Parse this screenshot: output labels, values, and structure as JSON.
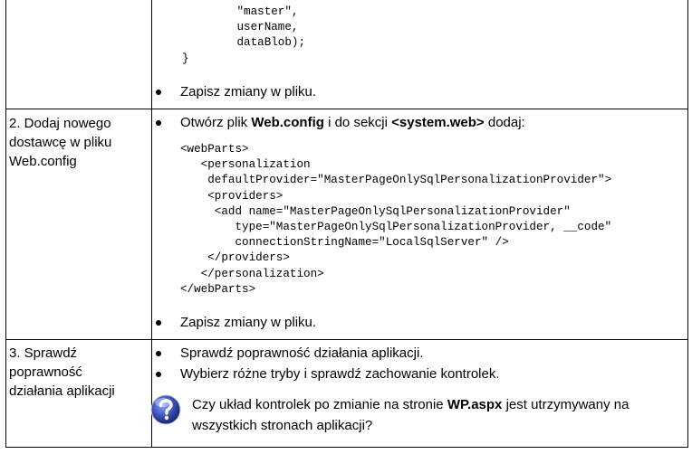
{
  "row1": {
    "code": "        \"master\",\n        userName,\n        dataBlob);\n}",
    "bullet": "Zapisz zmiany w pliku."
  },
  "row2": {
    "label": "2.  Dodaj nowego\ndostawcę w pliku\nWeb.config",
    "instr_pre": "Otwórz plik ",
    "instr_file": "Web.config",
    "instr_mid": " i do sekcji ",
    "instr_section": "<system.web>",
    "instr_post": " dodaj:",
    "code": "<webParts>\n   <personalization\n    defaultProvider=\"MasterPageOnlySqlPersonalizationProvider\">\n    <providers>\n     <add name=\"MasterPageOnlySqlPersonalizationProvider\"\n        type=\"MasterPageOnlySqlPersonalizationProvider, __code\"\n        connectionStringName=\"LocalSqlServer\" />\n    </providers>\n   </personalization>\n</webParts>",
    "bullet": "Zapisz zmiany w pliku."
  },
  "row3": {
    "label": "3.  Sprawdź\npoprawność\ndziałania aplikacji",
    "bullet1": "Sprawdź poprawność działania aplikacji.",
    "bullet2": "Wybierz różne tryby i sprawdź zachowanie kontrolek.",
    "question_pre": "Czy układ kontrolek po zmianie na stronie ",
    "question_page": "WP.aspx",
    "question_post": " jest utrzymywany na wszystkich stronach aplikacji?",
    "icon": "question-icon",
    "icon_color": "#3b4fb0"
  }
}
